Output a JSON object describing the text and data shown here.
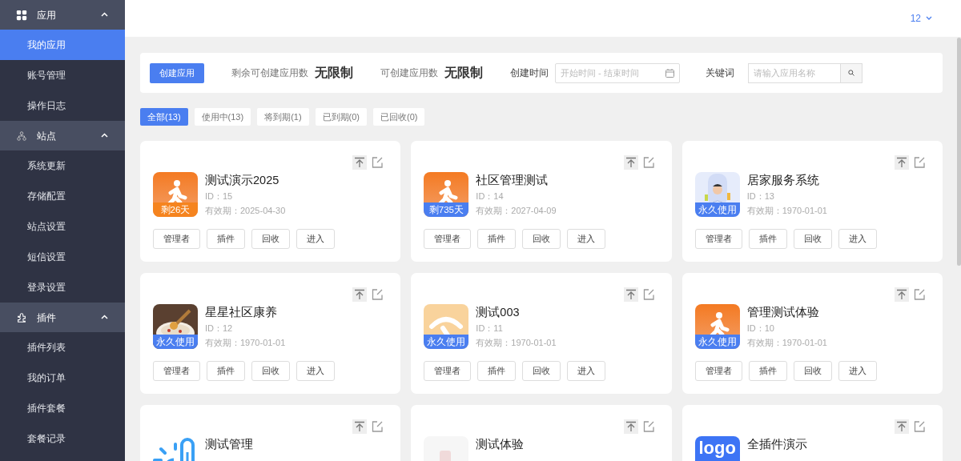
{
  "sidebar": {
    "groups": [
      {
        "kind": "grid",
        "label": "应用",
        "expanded": true,
        "items": [
          {
            "label": "我的应用",
            "selected": true
          },
          {
            "label": "账号管理",
            "selected": false
          },
          {
            "label": "操作日志",
            "selected": false
          }
        ]
      },
      {
        "kind": "sitemap",
        "label": "站点",
        "expanded": true,
        "items": [
          {
            "label": "系统更新",
            "selected": false
          },
          {
            "label": "存储配置",
            "selected": false
          },
          {
            "label": "站点设置",
            "selected": false
          },
          {
            "label": "短信设置",
            "selected": false
          },
          {
            "label": "登录设置",
            "selected": false
          }
        ]
      },
      {
        "kind": "puzzle",
        "label": "插件",
        "expanded": true,
        "items": [
          {
            "label": "插件列表",
            "selected": false
          },
          {
            "label": "我的订单",
            "selected": false
          },
          {
            "label": "插件套餐",
            "selected": false
          },
          {
            "label": "套餐记录",
            "selected": false
          }
        ]
      }
    ]
  },
  "header": {
    "user": "12"
  },
  "filter": {
    "create_button": "创建应用",
    "stats": [
      {
        "label": "剩余可创建应用数",
        "value": "无限制"
      },
      {
        "label": "可创建应用数",
        "value": "无限制"
      }
    ],
    "date_label": "创建时间",
    "date_placeholder": "开始时间 - 结束时间",
    "keyword_label": "关键词",
    "keyword_placeholder": "请输入应用名称"
  },
  "tabs": [
    {
      "label": "全部(13)",
      "selected": true
    },
    {
      "label": "使用中(13)",
      "selected": false
    },
    {
      "label": "将到期(1)",
      "selected": false
    },
    {
      "label": "已到期(0)",
      "selected": false
    },
    {
      "label": "已回收(0)",
      "selected": false
    }
  ],
  "apps": [
    {
      "kind": "runner",
      "name": "测试演示2025",
      "id": "ID：15",
      "expiry": "有效期：2025-04-30",
      "badge": {
        "text": "剩26天",
        "color": "#f5841f"
      },
      "actions": [
        "管理者",
        "插件",
        "回收",
        "进入"
      ]
    },
    {
      "kind": "runner",
      "name": "社区管理测试",
      "id": "ID：14",
      "expiry": "有效期：2027-04-09",
      "badge": {
        "text": "剩735天",
        "color": "#4a7ef0"
      },
      "actions": [
        "管理者",
        "插件",
        "回收",
        "进入"
      ]
    },
    {
      "kind": "doctor",
      "name": "居家服务系统",
      "id": "ID：13",
      "expiry": "有效期：1970-01-01",
      "badge": {
        "text": "永久使用",
        "color": "#4a7ef0"
      },
      "actions": [
        "管理者",
        "插件",
        "回收",
        "进入"
      ]
    },
    {
      "kind": "photo",
      "name": "星星社区康养",
      "id": "ID：12",
      "expiry": "有效期：1970-01-01",
      "badge": {
        "text": "永久使用",
        "color": "#4a7ef0"
      },
      "actions": [
        "管理者",
        "插件",
        "回收",
        "进入"
      ]
    },
    {
      "kind": "gauge",
      "name": "测试003",
      "id": "ID：11",
      "expiry": "有效期：1970-01-01",
      "badge": {
        "text": "永久使用",
        "color": "#4a7ef0"
      },
      "actions": [
        "管理者",
        "插件",
        "回收",
        "进入"
      ]
    },
    {
      "kind": "runner",
      "name": "管理测试体验",
      "id": "ID：10",
      "expiry": "有效期：1970-01-01",
      "badge": {
        "text": "永久使用",
        "color": "#4a7ef0"
      },
      "actions": [
        "管理者",
        "插件",
        "回收",
        "进入"
      ]
    },
    {
      "kind": "thermometer",
      "name": "测试管理"
    },
    {
      "kind": "product",
      "name": "测试体验"
    },
    {
      "kind": "logo",
      "logo_text": "logo",
      "name": "全插件演示"
    }
  ]
}
